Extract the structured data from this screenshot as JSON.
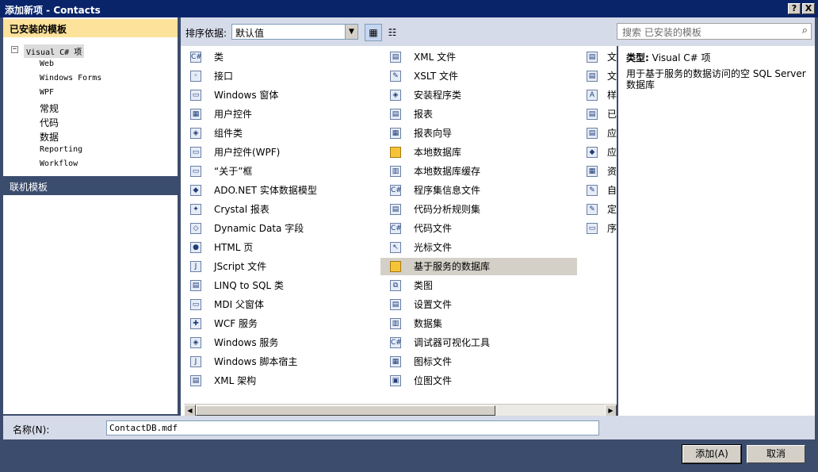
{
  "window": {
    "title": "添加新项 - Contacts",
    "help_glyph": "?",
    "close_glyph": "X"
  },
  "left": {
    "installed_header": "已安装的模板",
    "tree_expand": "−",
    "root": "Visual C# 项",
    "children": [
      "Web",
      "Windows Forms",
      "WPF",
      "常规",
      "代码",
      "数据",
      "Reporting",
      "Workflow"
    ],
    "online_header": "联机模板"
  },
  "toolbar": {
    "sort_label": "排序依据:",
    "sort_value": "默认值",
    "search_placeholder": "搜索 已安装的模板"
  },
  "templates": {
    "col1": [
      "类",
      "接口",
      "Windows 窗体",
      "用户控件",
      "组件类",
      "用户控件(WPF)",
      "“关于”框",
      "ADO.NET 实体数据模型",
      "Crystal 报表",
      "Dynamic Data 字段",
      "HTML 页",
      "JScript 文件",
      "LINQ to SQL 类",
      "MDI 父窗体",
      "WCF 服务",
      "Windows 服务",
      "Windows 脚本宿主",
      "XML 架构"
    ],
    "col2": [
      "XML 文件",
      "XSLT 文件",
      "安装程序类",
      "报表",
      "报表向导",
      "本地数据库",
      "本地数据库缓存",
      "程序集信息文件",
      "代码分析规则集",
      "代码文件",
      "光标文件",
      "基于服务的数据库",
      "类图",
      "设置文件",
      "数据集",
      "调试器可视化工具",
      "图标文件",
      "位图文件"
    ],
    "col3": [
      "文",
      "文",
      "样",
      "已",
      "应",
      "应",
      "资",
      "自",
      "定",
      "序"
    ],
    "selected": "基于服务的数据库"
  },
  "description": {
    "type_label": "类型:",
    "type_value": "Visual C# 项",
    "text": "用于基于服务的数据访问的空 SQL Server 数据库"
  },
  "name_field": {
    "label": "名称(N):",
    "value": "ContactDB.mdf"
  },
  "buttons": {
    "add": "添加(A)",
    "cancel": "取消"
  },
  "colors": {
    "title_bar": "#0a246a",
    "frame": "#3c4c6c",
    "installed_header": "#fde29b",
    "selection": "#d4d0c8"
  }
}
